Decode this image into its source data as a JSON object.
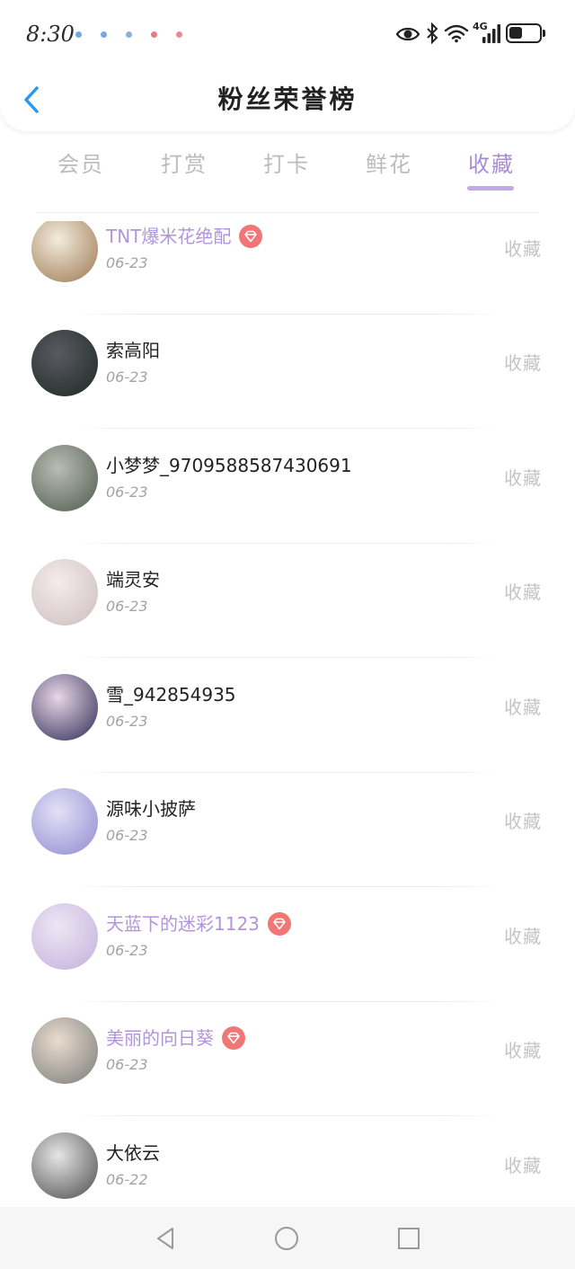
{
  "status_bar": {
    "time": "8:30",
    "notification_icons": [
      {
        "icon": "notification-icon",
        "color": "#7aa6de"
      },
      {
        "icon": "notification-icon",
        "color": "#7aa6de"
      },
      {
        "icon": "notification-icon",
        "color": "#8ab0e2"
      },
      {
        "icon": "notification-icon",
        "color": "#e27d8e"
      },
      {
        "icon": "notification-icon",
        "color": "#e88a98"
      }
    ],
    "network_label": "4G",
    "signal_bars": 4,
    "battery_level": 0.45,
    "icons": [
      "eye-icon",
      "bluetooth-icon",
      "wifi-icon",
      "signal-icon",
      "battery-icon"
    ]
  },
  "header": {
    "title": "粉丝荣誉榜",
    "back_icon": "chevron-left-icon"
  },
  "tabs": {
    "items": [
      {
        "label": "会员"
      },
      {
        "label": "打赏"
      },
      {
        "label": "打卡"
      },
      {
        "label": "鲜花"
      },
      {
        "label": "收藏"
      }
    ],
    "active_index": 4
  },
  "colors": {
    "accent": "#a88bd9",
    "indicator": "#c2a8e8",
    "vip_name": "#b294de",
    "text": "#222222",
    "date": "#a3a3a3",
    "action": "#c4c4c4",
    "back": "#2b97ee",
    "badge": "#f27676",
    "tab_inactive": "#bcbcbc"
  },
  "list": {
    "badge_icon": "diamond-badge-icon",
    "items": [
      {
        "name": "TNT爆米花绝配",
        "date": "06-23",
        "action": "收藏",
        "vip": true,
        "avatar_colors": [
          "#f3ecdc",
          "#9c7750"
        ]
      },
      {
        "name": "索高阳",
        "date": "06-23",
        "action": "收藏",
        "vip": false,
        "avatar_colors": [
          "#5a5a62",
          "#1e2a24"
        ]
      },
      {
        "name": "小梦梦_9709588587430691",
        "date": "06-23",
        "action": "收藏",
        "vip": false,
        "avatar_colors": [
          "#b9bdb4",
          "#4f5a4c"
        ]
      },
      {
        "name": "端灵安",
        "date": "06-23",
        "action": "收藏",
        "vip": false,
        "avatar_colors": [
          "#f4ecec",
          "#cdbdbd"
        ]
      },
      {
        "name": "雪_942854935",
        "date": "06-23",
        "action": "收藏",
        "vip": false,
        "avatar_colors": [
          "#e7d6e6",
          "#2e2b55"
        ]
      },
      {
        "name": "源味小披萨",
        "date": "06-23",
        "action": "收藏",
        "vip": false,
        "avatar_colors": [
          "#e4e0f6",
          "#8f8ad0"
        ]
      },
      {
        "name": "天蓝下的迷彩1123",
        "date": "06-23",
        "action": "收藏",
        "vip": true,
        "avatar_colors": [
          "#efe6f4",
          "#c2b0dc"
        ]
      },
      {
        "name": "美丽的向日葵",
        "date": "06-23",
        "action": "收藏",
        "vip": true,
        "avatar_colors": [
          "#e9dccd",
          "#7a7a7a"
        ]
      },
      {
        "name": "大依云",
        "date": "06-22",
        "action": "收藏",
        "vip": false,
        "avatar_colors": [
          "#e6e6e6",
          "#4a4a4a"
        ]
      }
    ]
  },
  "nav_bar": {
    "icons": [
      "back-triangle-icon",
      "home-circle-icon",
      "recents-square-icon"
    ]
  }
}
